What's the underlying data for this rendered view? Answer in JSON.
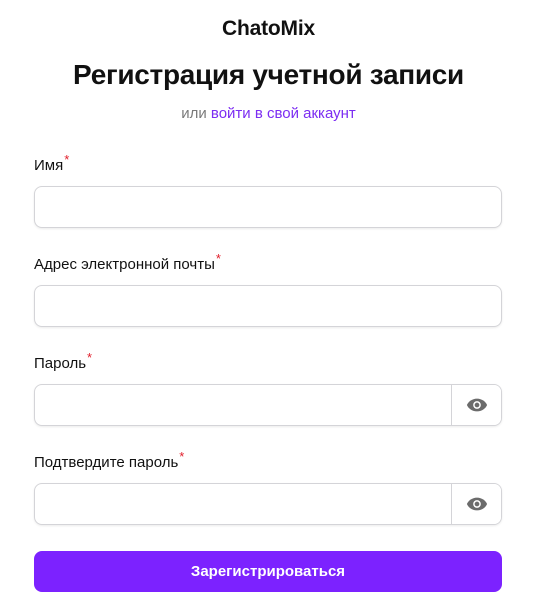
{
  "brand": "ChatoMix",
  "title": "Регистрация учетной записи",
  "subtitle": {
    "prefix": "или",
    "link": "войти в свой аккаунт"
  },
  "fields": {
    "name": {
      "label": "Имя",
      "required_mark": "*",
      "value": "",
      "placeholder": ""
    },
    "email": {
      "label": "Адрес электронной почты",
      "required_mark": "*",
      "value": "",
      "placeholder": ""
    },
    "password": {
      "label": "Пароль",
      "required_mark": "*",
      "value": "",
      "placeholder": ""
    },
    "confirm_password": {
      "label": "Подтвердите пароль",
      "required_mark": "*",
      "value": "",
      "placeholder": ""
    }
  },
  "submit_label": "Зарегистрироваться",
  "colors": {
    "accent": "#7c22ff",
    "link": "#7c2df2",
    "required": "#e11d2a",
    "muted": "#7a7a7a",
    "icon": "#6b6b6b"
  },
  "icons": {
    "password_toggle": "eye-icon",
    "confirm_password_toggle": "eye-icon"
  }
}
